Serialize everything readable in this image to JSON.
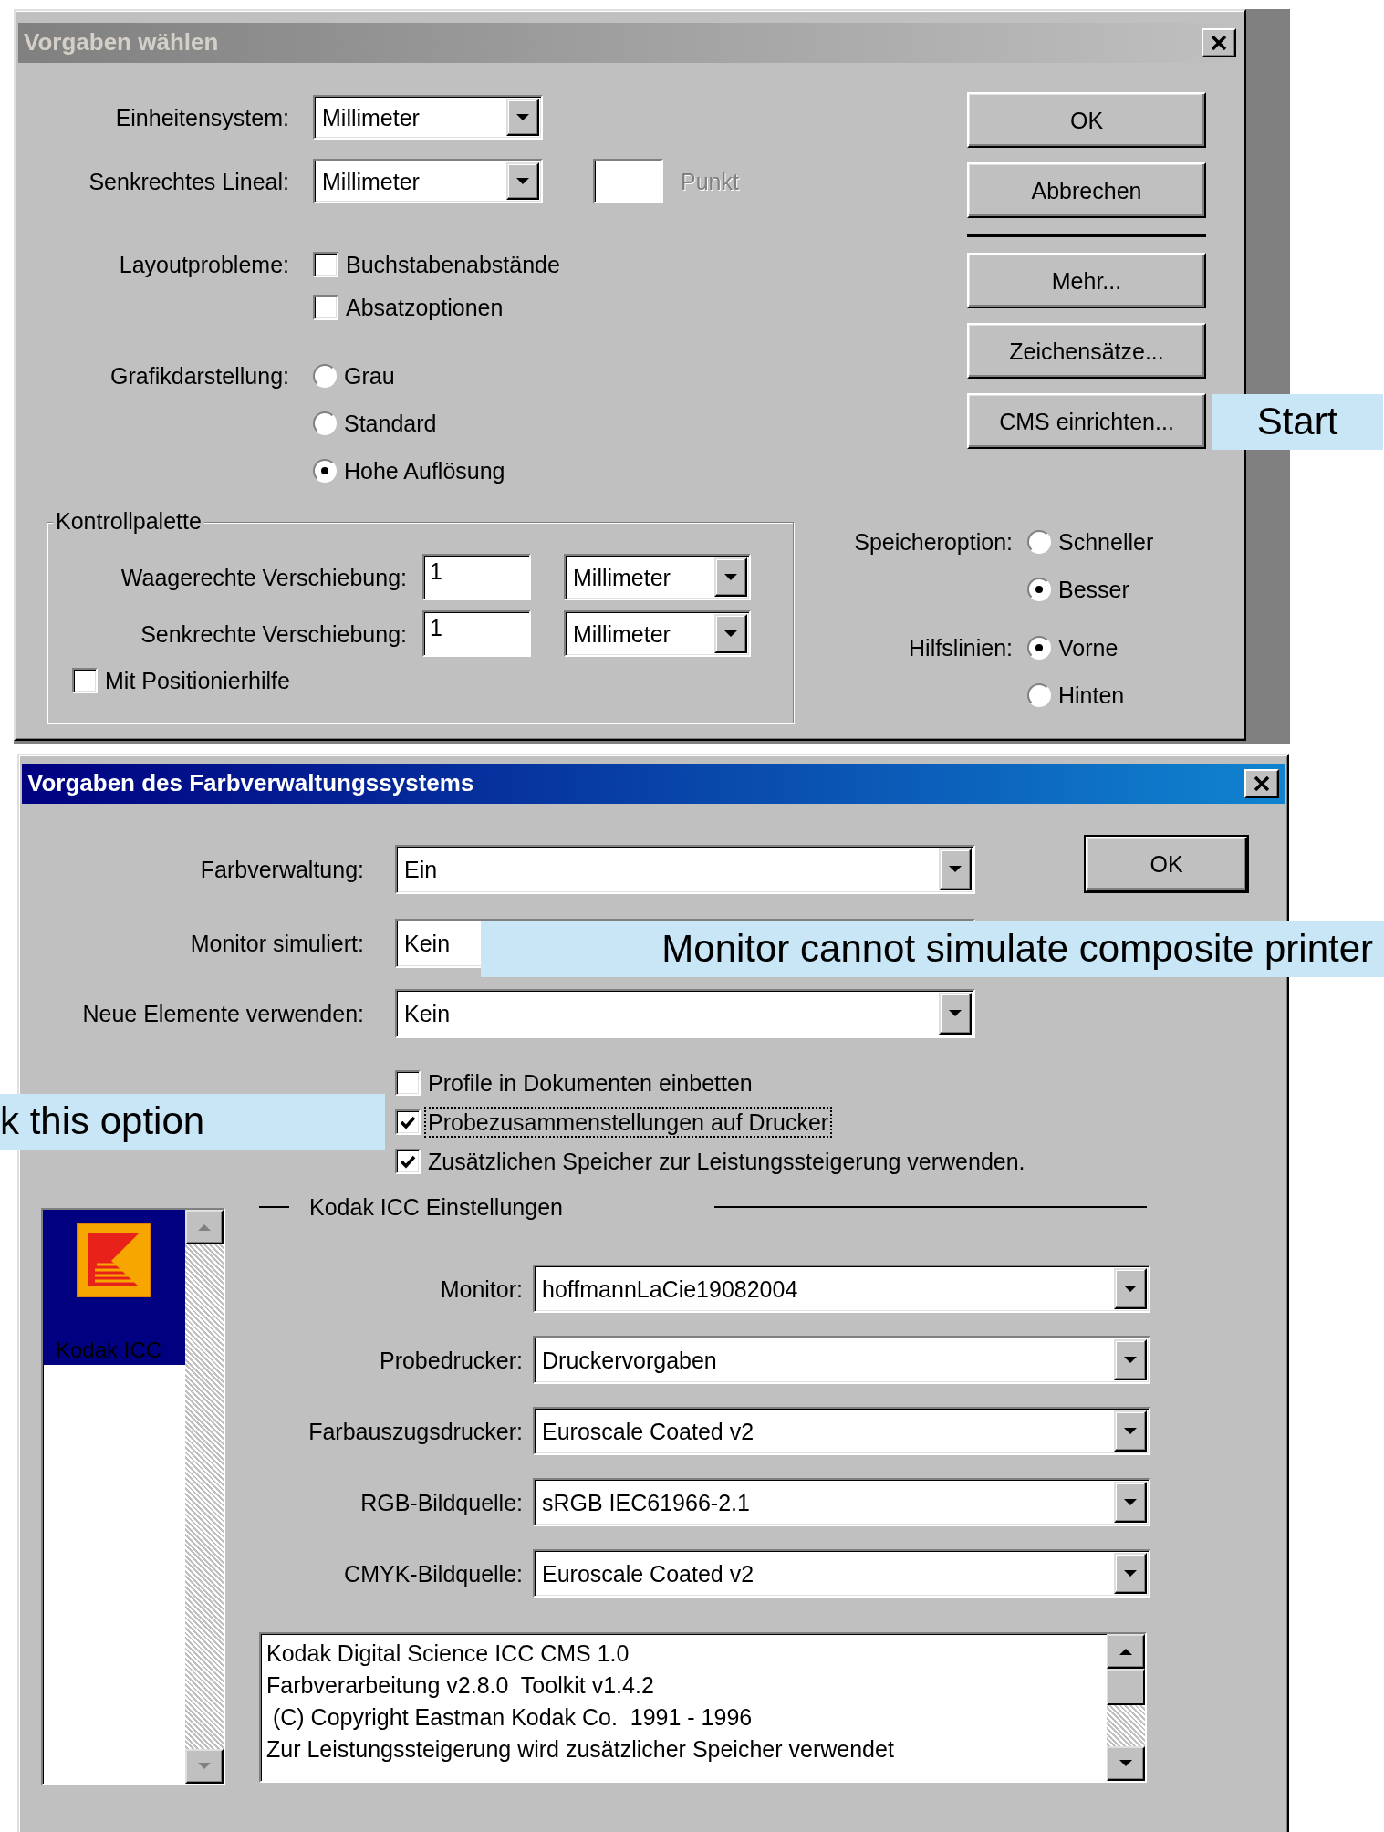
{
  "preferences_dialog": {
    "title": "Vorgaben wählen",
    "unit_system": {
      "label": "Einheitensystem:",
      "value": "Millimeter"
    },
    "vertical_ruler": {
      "label": "Senkrechtes Lineal:",
      "value": "Millimeter",
      "point_label": "Punkt"
    },
    "layout_problems": {
      "label": "Layoutprobleme:",
      "options": [
        {
          "label": "Buchstabenabstände",
          "checked": false
        },
        {
          "label": "Absatzoptionen",
          "checked": false
        }
      ]
    },
    "graphics_display": {
      "label": "Grafikdarstellung:",
      "options": [
        {
          "label": "Grau",
          "selected": false
        },
        {
          "label": "Standard",
          "selected": false
        },
        {
          "label": "Hohe Auflösung",
          "selected": true
        }
      ]
    },
    "control_palette": {
      "title": "Kontrollpalette",
      "rows": [
        {
          "label": "Waagerechte Verschiebung:",
          "value": "1",
          "unit": "Millimeter"
        },
        {
          "label": "Senkrechte Verschiebung:",
          "value": "1",
          "unit": "Millimeter"
        }
      ],
      "positioning_aid": {
        "label": "Mit Positionierhilfe",
        "checked": false
      }
    },
    "save_option": {
      "label": "Speicheroption:",
      "options": [
        {
          "label": "Schneller",
          "selected": false
        },
        {
          "label": "Besser",
          "selected": true
        }
      ]
    },
    "guides": {
      "label": "Hilfslinien:",
      "options": [
        {
          "label": "Vorne",
          "selected": true
        },
        {
          "label": "Hinten",
          "selected": false
        }
      ]
    },
    "buttons": [
      {
        "label": "OK"
      },
      {
        "label": "Abbrechen"
      },
      {
        "label": "Mehr..."
      },
      {
        "label": "Zeichensätze..."
      },
      {
        "label": "CMS einrichten...",
        "callout": "Start"
      }
    ]
  },
  "cms_dialog": {
    "title": "Vorgaben des Farbverwaltungssystems",
    "ok_button": "OK",
    "fields": [
      {
        "label": "Farbverwaltung:",
        "value": "Ein"
      },
      {
        "label": "Monitor simuliert:",
        "value": "Kein",
        "callout": "Monitor cannot simulate composite printer"
      },
      {
        "label": "Neue Elemente verwenden:",
        "value": "Kein"
      }
    ],
    "options": [
      {
        "label": "Profile in Dokumenten einbetten",
        "checked": false,
        "focused": false
      },
      {
        "label": "Probezusammenstellungen auf Drucker",
        "checked": true,
        "focused": true,
        "callout": "k this option"
      },
      {
        "label": "Zusätzlichen Speicher zur Leistungssteigerung verwenden.",
        "checked": true,
        "focused": false
      }
    ],
    "modules": [
      {
        "label": "Kodak ICC",
        "selected": true
      }
    ],
    "kodak_settings": {
      "title": "Kodak ICC Einstellungen",
      "fields": [
        {
          "label": "Monitor:",
          "value": "hoffmannLaCie19082004"
        },
        {
          "label": "Probedrucker:",
          "value": "Druckervorgaben"
        },
        {
          "label": "Farbauszugsdrucker:",
          "value": "Euroscale Coated v2"
        },
        {
          "label": "RGB-Bildquelle:",
          "value": "sRGB IEC61966-2.1"
        },
        {
          "label": "CMYK-Bildquelle:",
          "value": "Euroscale Coated v2"
        }
      ]
    },
    "info_lines": [
      "Kodak Digital Science ICC CMS 1.0",
      "Farbverarbeitung v2.8.0  Toolkit v1.4.2",
      " (C) Copyright Eastman Kodak Co.  1991 - 1996",
      "Zur Leistungssteigerung wird zusätzlicher Speicher verwendet"
    ]
  }
}
